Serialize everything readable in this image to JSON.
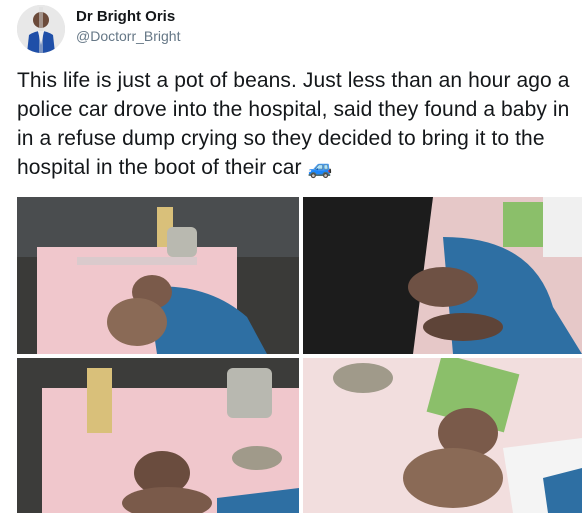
{
  "author": {
    "name": "Dr Bright Oris",
    "handle": "@Doctorr_Bright",
    "avatar_icon": "profile-photo"
  },
  "tweet": {
    "text": "This life is just a pot of beans. Just less than an hour ago a police car drove into the hospital, said they found a baby in in a refuse dump crying so they decided to bring it to the hospital in the boot of their car",
    "emoji": "🚙"
  },
  "media": {
    "count": 4,
    "colors": {
      "pink_sheet": "#f0c7cc",
      "blue_fabric": "#2e6fa3",
      "skin": "#7a5a4a",
      "dark": "#2a2a2a"
    }
  }
}
